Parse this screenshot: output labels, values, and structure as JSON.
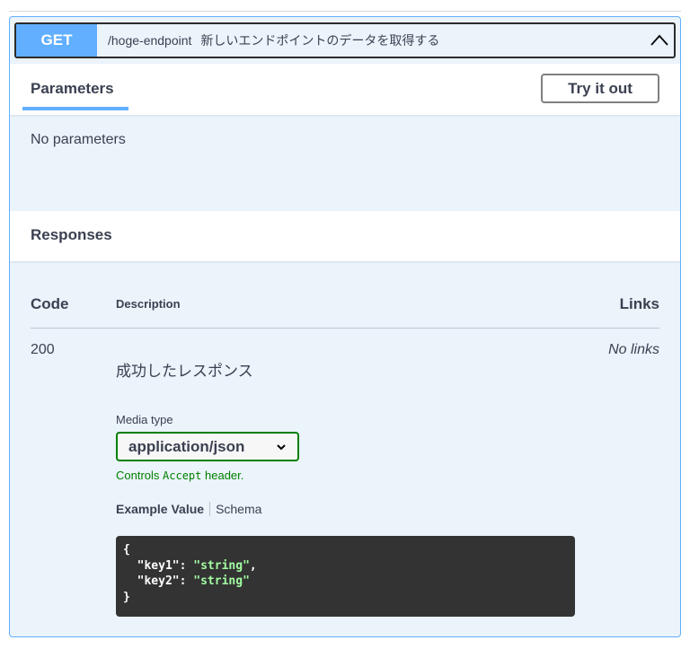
{
  "operation": {
    "method": "GET",
    "path": "/hoge-endpoint",
    "summary": "新しいエンドポイントのデータを取得する"
  },
  "parameters": {
    "tab": "Parameters",
    "try_button": "Try it out",
    "empty": "No parameters"
  },
  "responses": {
    "title": "Responses",
    "headers": {
      "code": "Code",
      "description": "Description",
      "links": "Links"
    },
    "rows": [
      {
        "code": "200",
        "description": "成功したレスポンス",
        "links": "No links",
        "media_type_label": "Media type",
        "media_type": "application/json",
        "controls_pre": "Controls ",
        "controls_code": "Accept",
        "controls_post": " header.",
        "example_tab": "Example Value",
        "schema_tab": "Schema",
        "example": {
          "open": "{",
          "k1": "  \"key1\": ",
          "v1": "\"string\"",
          "c1": ",",
          "k2": "  \"key2\": ",
          "v2": "\"string\"",
          "close": "}"
        }
      }
    ]
  }
}
